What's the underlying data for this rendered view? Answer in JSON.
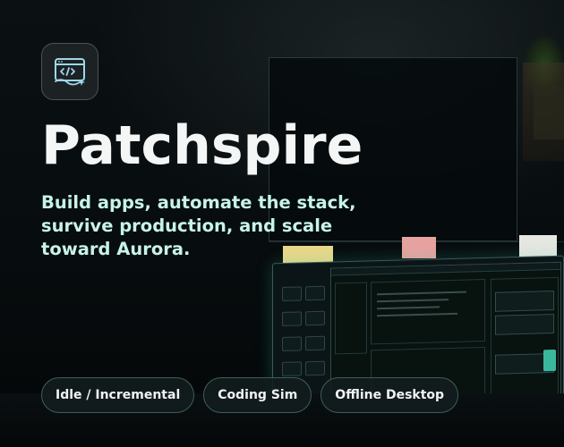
{
  "app": {
    "title": "Patchspire",
    "tagline_lines": [
      "Build apps, automate the stack,",
      "survive production, and scale",
      "toward Aurora."
    ]
  },
  "logo": {
    "icon": "code-window-icon"
  },
  "tags": [
    {
      "label": "Idle / Incremental"
    },
    {
      "label": "Coding Sim"
    },
    {
      "label": "Offline Desktop"
    }
  ],
  "colors": {
    "background": "#05090b",
    "title": "#f4f6f6",
    "tagline": "#c6f3ea",
    "accent": "#3bb79e",
    "pill_border": "#3f5d5b"
  }
}
